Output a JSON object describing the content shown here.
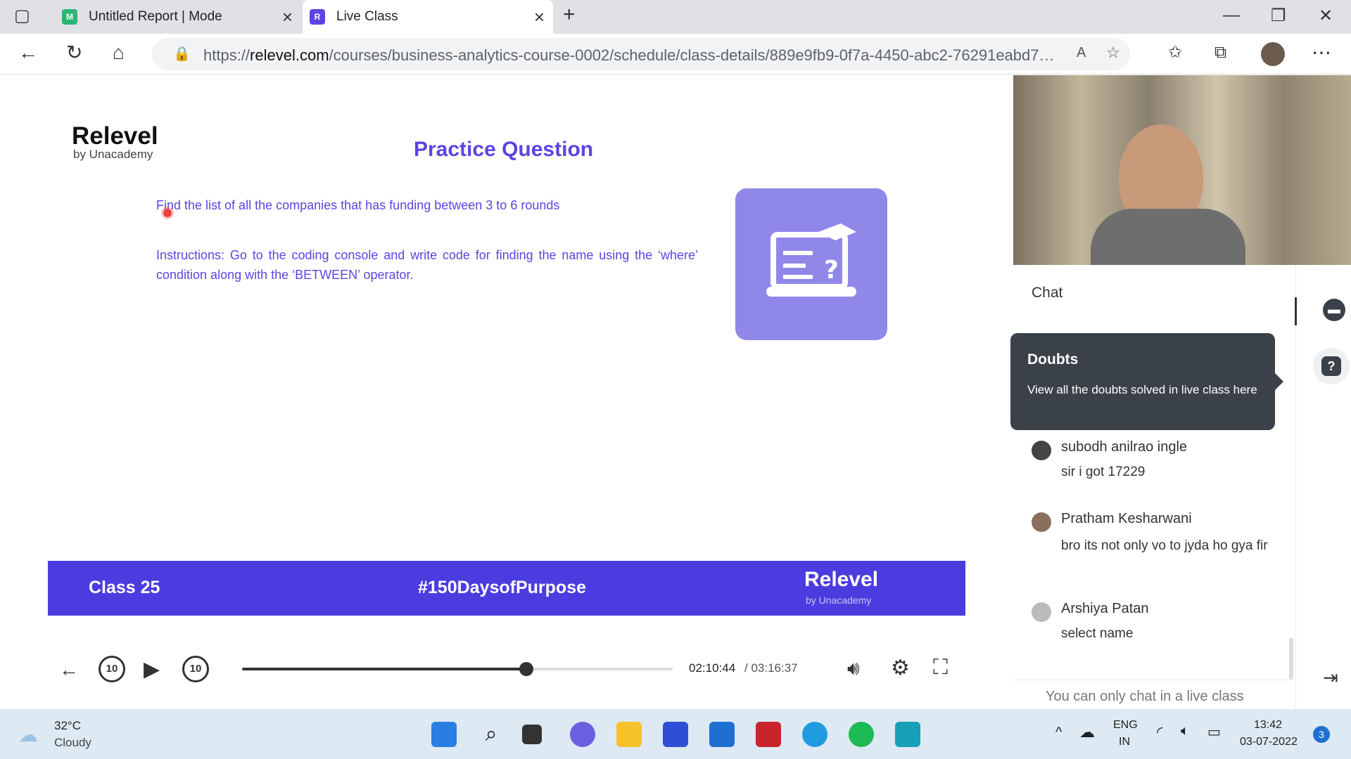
{
  "browser": {
    "tabs": [
      {
        "title": "Untitled Report | Mode"
      },
      {
        "title": "Live Class"
      }
    ],
    "url_domain": "relevel.com",
    "url_rest": "/courses/business-analytics-course-0002/schedule/class-details/889e9fb9-0f7a-4450-abc2-76291eabd71b/live-...",
    "url_scheme": "https://"
  },
  "slide": {
    "brand": "Relevel",
    "brand_sub": "by Unacademy",
    "title": "Practice Question",
    "question": "Find the list of all the companies that has funding between 3 to 6 rounds",
    "instructions": "Instructions: Go to the coding console and write code for finding the name using the ‘where’ condition along with the ‘BETWEEN’ operator.",
    "footer_class": "Class 25",
    "footer_hashtag": "#150DaysofPurpose",
    "footer_brand": "Relevel",
    "footer_brand_sub": "by Unacademy"
  },
  "player": {
    "current_time": "02:10:44",
    "total_time": "/ 03:16:37",
    "progress": 0.66,
    "skip_back": "10",
    "skip_fwd": "10"
  },
  "chat": {
    "title": "Chat",
    "tooltip_title": "Doubts",
    "tooltip_body": "View all the doubts solved in live class here",
    "messages": [
      {
        "name": "subodh anilrao ingle",
        "text": "sir i got 17229"
      },
      {
        "name": "Pratham Kesharwani",
        "text": "bro its not only vo to jyda ho gya fir"
      },
      {
        "name": "Arshiya Patan",
        "text": "select name"
      }
    ],
    "input_placeholder": "You can only chat in a live class"
  },
  "taskbar": {
    "weather_temp": "32°C",
    "weather_desc": "Cloudy",
    "lang1": "ENG",
    "lang2": "IN",
    "time": "13:42",
    "date": "03-07-2022",
    "notif": "3"
  },
  "colors": {
    "accent": "#4b3ce0",
    "slide_text": "#5b45e0",
    "tooltip": "#3a4149"
  }
}
